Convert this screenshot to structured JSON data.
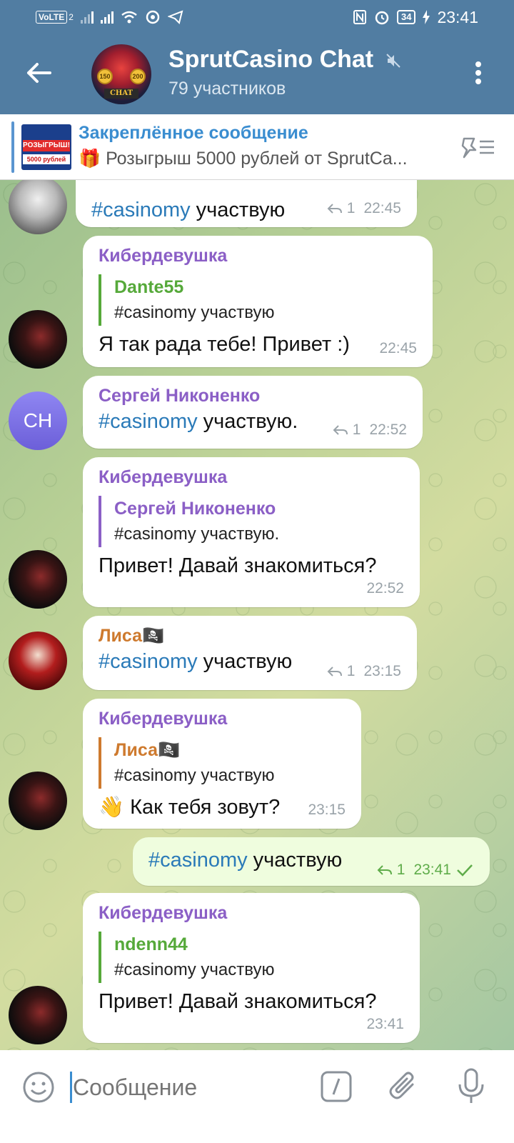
{
  "status_bar": {
    "volte": "VoLTE",
    "sim": "2",
    "battery": "34",
    "time": "23:41"
  },
  "header": {
    "title": "SprutCasino Chat",
    "subtitle": "79 участников",
    "avatar_tag": "CHAT",
    "avatar_coin_left": "150",
    "avatar_coin_right": "200"
  },
  "pinned": {
    "title": "Закреплённое сообщение",
    "text": "🎁 Розыгрыш 5000 рублей от SprutCa...",
    "thumb_banner": "РОЗЫГРЫШ!",
    "thumb_amount": "5000 рублей"
  },
  "messages": [
    {
      "sender": "",
      "hashtag": "#casinomy",
      "text": " участвую",
      "replies": "1",
      "time": "22:45"
    },
    {
      "sender": "Кибердевушка",
      "reply_name": "Dante55",
      "reply_text": "#casinomy участвую",
      "text": "Я так рада тебе! Привет :)",
      "time": "22:45"
    },
    {
      "sender": "Сергей Никоненко",
      "avatar_initials": "СН",
      "hashtag": "#casinomy",
      "text": " участвую.",
      "replies": "1",
      "time": "22:52"
    },
    {
      "sender": "Кибердевушка",
      "reply_name": "Сергей Никоненко",
      "reply_text": "#casinomy участвую.",
      "text": "Привет! Давай знакомиться?",
      "time": "22:52"
    },
    {
      "sender": "Лиса🏴‍☠️",
      "hashtag": "#casinomy",
      "text": " участвую",
      "replies": "1",
      "time": "23:15"
    },
    {
      "sender": "Кибердевушка",
      "reply_name": "Лиса🏴‍☠️",
      "reply_text": "#casinomy участвую",
      "text": "👋 Как тебя зовут?",
      "time": "23:15"
    },
    {
      "outgoing": true,
      "hashtag": "#casinomy",
      "text": " участвую",
      "replies": "1",
      "time": "23:41"
    },
    {
      "sender": "Кибердевушка",
      "reply_name": "ndenn44",
      "reply_text": "#casinomy участвую",
      "text": "Привет! Давай знакомиться?",
      "time": "23:41"
    }
  ],
  "input": {
    "placeholder": "Сообщение"
  },
  "colors": {
    "header": "#517da2",
    "accent": "#3a8dd0",
    "sender_purple": "#8b5fc6",
    "sender_orange": "#ce7a2e",
    "reply_green": "#56a93a",
    "outgoing_bubble": "#effdde"
  },
  "icons": [
    "back-arrow-icon",
    "mute-icon",
    "more-vert-icon",
    "pinned-list-icon",
    "reply-icon",
    "check-icon",
    "emoji-icon",
    "command-icon",
    "attach-icon",
    "mic-icon"
  ]
}
